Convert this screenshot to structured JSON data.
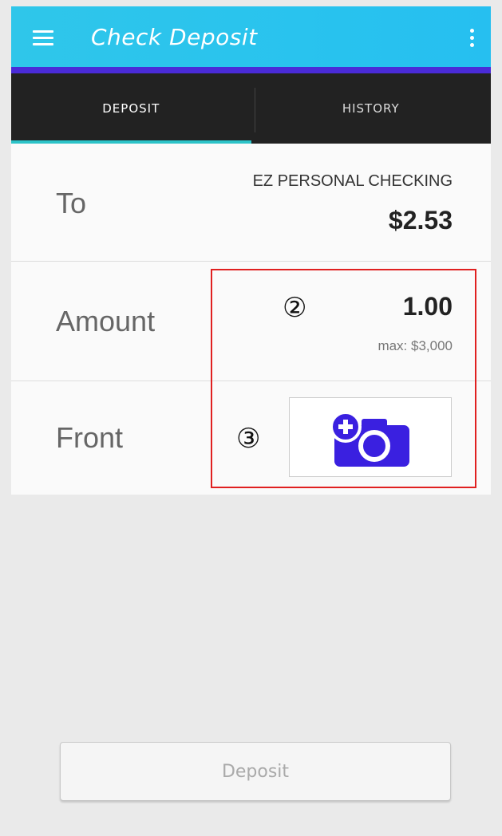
{
  "appbar": {
    "title": "Check Deposit"
  },
  "tabs": [
    {
      "label": "DEPOSIT",
      "active": true
    },
    {
      "label": "HISTORY",
      "active": false
    }
  ],
  "to": {
    "label": "To",
    "account": "EZ PERSONAL CHECKING",
    "balance": "$2.53"
  },
  "amount": {
    "label": "Amount",
    "value": "1.00",
    "max": "max: $3,000"
  },
  "front": {
    "label": "Front"
  },
  "markers": {
    "amount": "②",
    "front": "③"
  },
  "deposit_button": {
    "label": "Deposit"
  },
  "colors": {
    "appbar": "#2fc6ea",
    "appbar_underline": "#4a2bd8",
    "tabbar": "#222222",
    "tab_indicator": "#2cc3c8",
    "camera_icon": "#3a20e0",
    "highlight": "#e02020"
  },
  "icons": {
    "menu": "hamburger-menu-icon",
    "overflow": "overflow-menu-icon",
    "camera": "camera-add-icon"
  }
}
